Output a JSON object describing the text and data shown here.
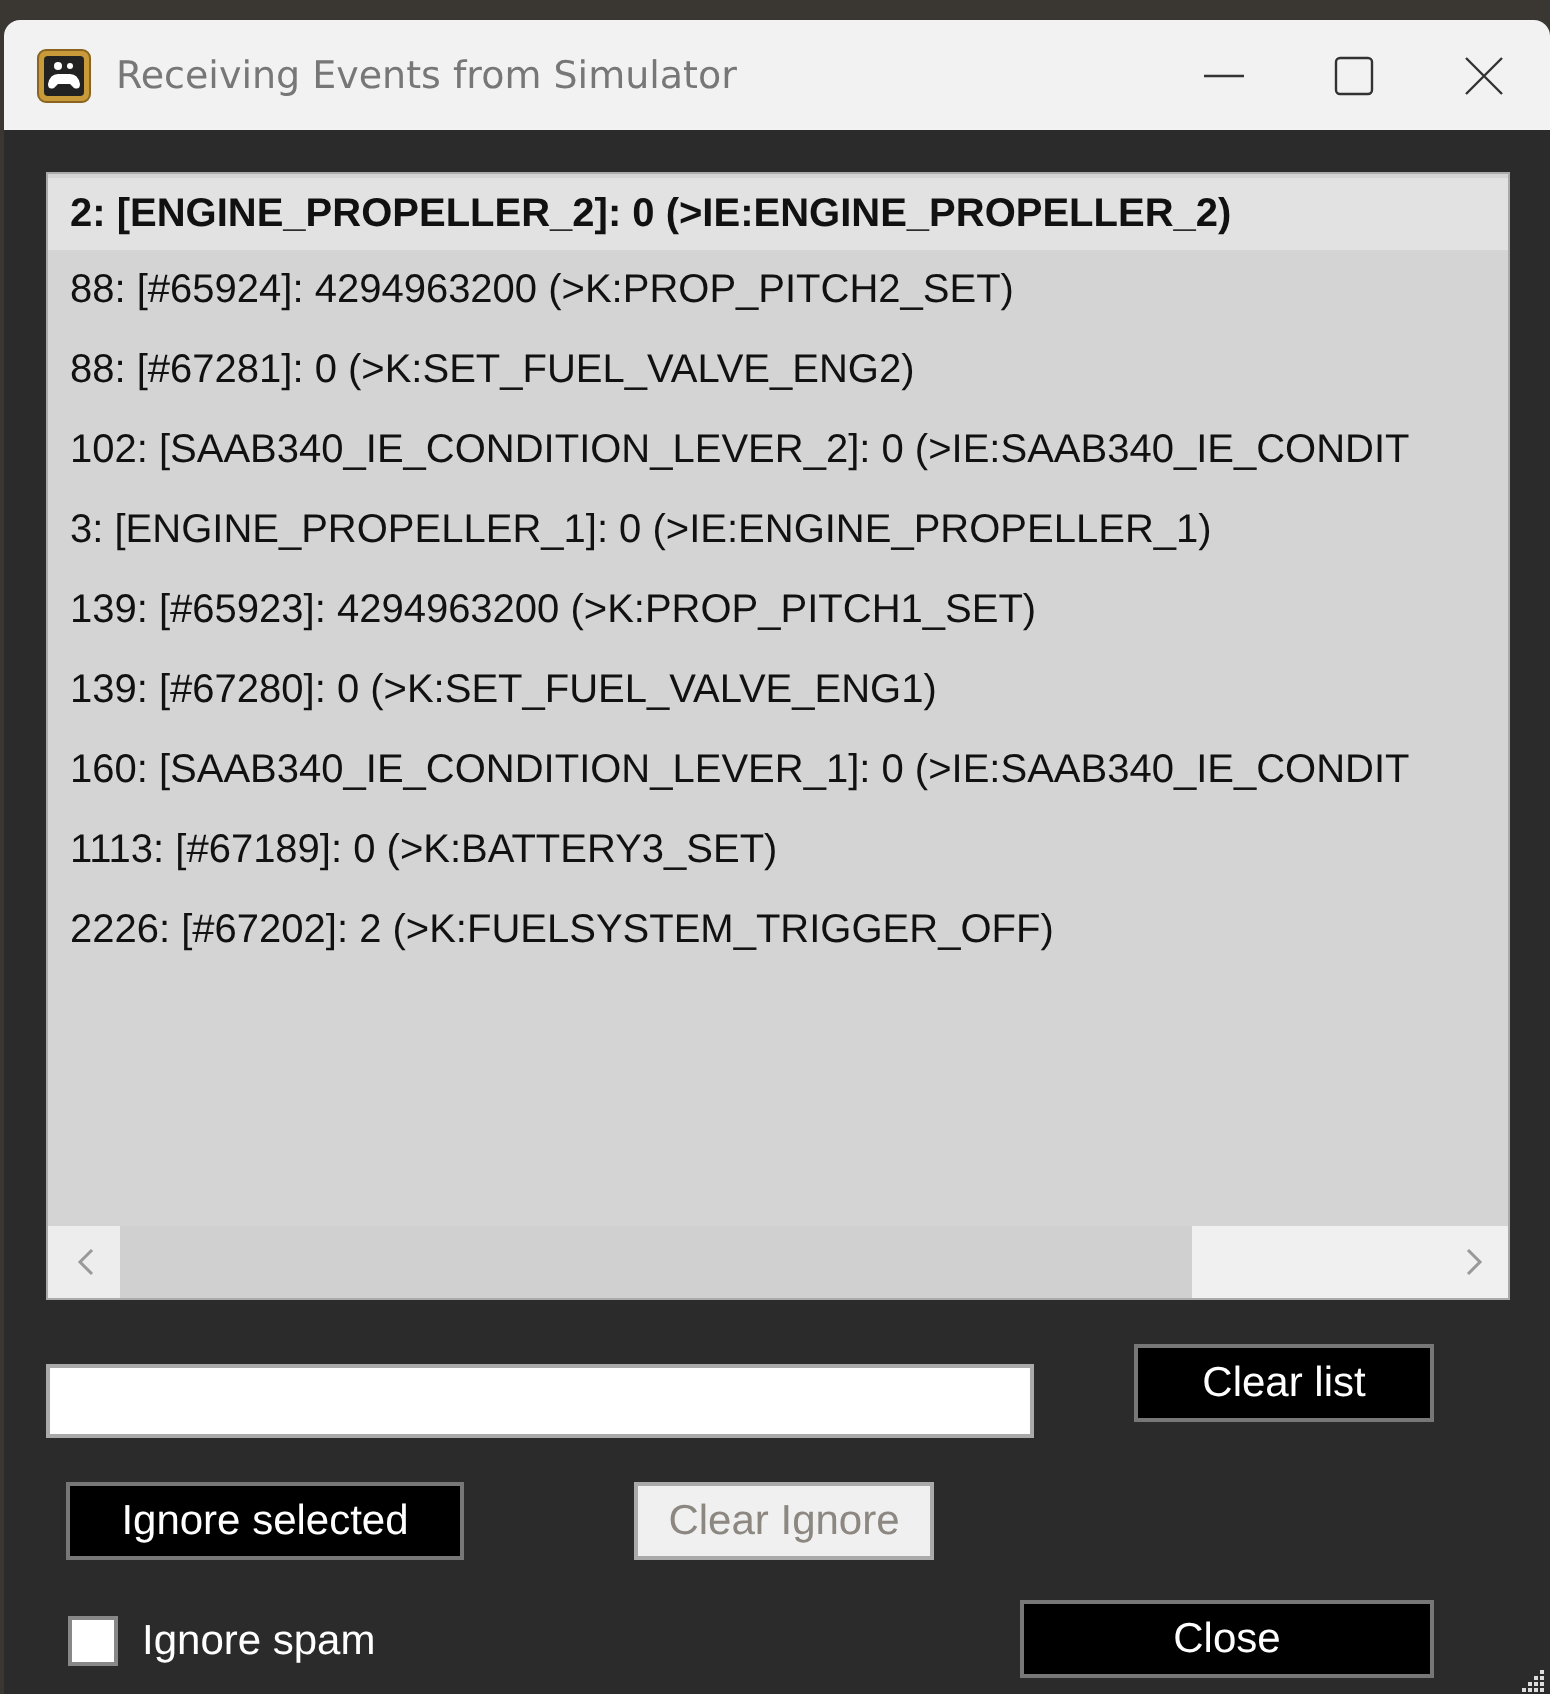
{
  "window": {
    "title": "Receiving Events from Simulator"
  },
  "events": [
    {
      "text": "2: [ENGINE_PROPELLER_2]: 0 (>IE:ENGINE_PROPELLER_2)",
      "selected": true
    },
    {
      "text": "88: [#65924]: 4294963200 (>K:PROP_PITCH2_SET)",
      "selected": false
    },
    {
      "text": "88: [#67281]: 0 (>K:SET_FUEL_VALVE_ENG2)",
      "selected": false
    },
    {
      "text": "102: [SAAB340_IE_CONDITION_LEVER_2]: 0 (>IE:SAAB340_IE_CONDIT",
      "selected": false
    },
    {
      "text": "3: [ENGINE_PROPELLER_1]: 0 (>IE:ENGINE_PROPELLER_1)",
      "selected": false
    },
    {
      "text": "139: [#65923]: 4294963200 (>K:PROP_PITCH1_SET)",
      "selected": false
    },
    {
      "text": "139: [#67280]: 0 (>K:SET_FUEL_VALVE_ENG1)",
      "selected": false
    },
    {
      "text": "160: [SAAB340_IE_CONDITION_LEVER_1]: 0 (>IE:SAAB340_IE_CONDIT",
      "selected": false
    },
    {
      "text": "1113: [#67189]: 0 (>K:BATTERY3_SET)",
      "selected": false
    },
    {
      "text": "2226: [#67202]: 2 (>K:FUELSYSTEM_TRIGGER_OFF)",
      "selected": false
    }
  ],
  "buttons": {
    "clear_list": {
      "label": "Clear list",
      "disabled": false
    },
    "ignore_selected": {
      "label": "Ignore selected",
      "disabled": false
    },
    "clear_ignore": {
      "label": "Clear Ignore",
      "disabled": true
    },
    "close": {
      "label": "Close",
      "disabled": false
    }
  },
  "ignore_spam": {
    "label": "Ignore spam",
    "checked": false
  }
}
